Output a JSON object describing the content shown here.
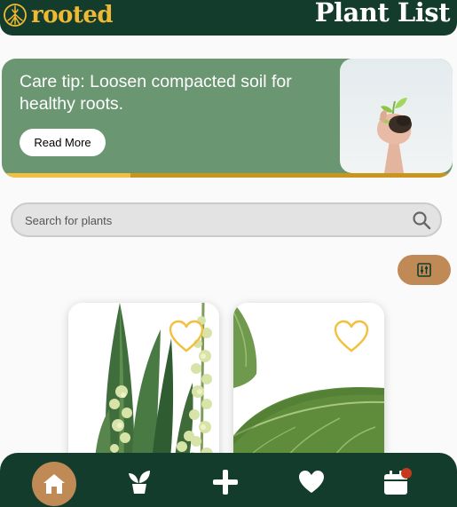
{
  "header": {
    "logo_text": "rooted",
    "title": "Plant List"
  },
  "banner": {
    "text": "Care tip: Loosen compacted soil for healthy roots.",
    "button_label": "Read More",
    "progress_fraction": 0.285
  },
  "search": {
    "placeholder": "Search for plants",
    "value": ""
  },
  "icons": {
    "logo": "roots-logo-icon",
    "search": "search-icon",
    "filter": "sliders-icon",
    "favorite": "heart-outline-icon",
    "nav": [
      "home-icon",
      "potted-plant-icon",
      "plus-icon",
      "heart-icon",
      "calendar-icon"
    ]
  },
  "cards": [
    {
      "image": "snake-plant-photo",
      "favorited": false
    },
    {
      "image": "fiddle-leaf-photo",
      "favorited": false
    }
  ],
  "colors": {
    "header_bg": "#143c2c",
    "logo_gold": "#f0b935",
    "banner_green": "#6b9672",
    "accent_tan": "#bf8a55",
    "heart_yellow": "#f3bf3e",
    "notification_red": "#c43a1c"
  }
}
